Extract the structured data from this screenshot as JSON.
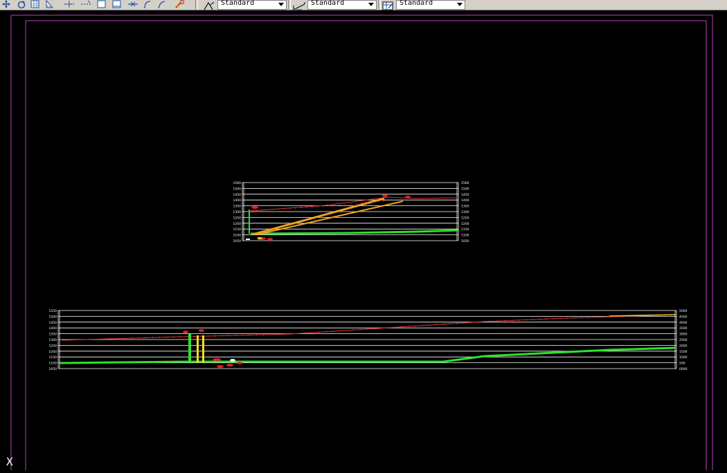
{
  "toolbar": {
    "icons": [
      "pan-icon",
      "orbit-icon",
      "grid-view-icon",
      "section-icon",
      "line-align-icon",
      "line-dash-icon",
      "rect-icon",
      "rect2-icon",
      "move-icon",
      "arc-icon",
      "curve-icon",
      "tool-settings-icon"
    ],
    "text_style": {
      "icon": "text-style-icon",
      "value": "Standard"
    },
    "dim_style": {
      "icon": "dimension-style-icon",
      "value": "Standard"
    },
    "table_style": {
      "icon": "table-style-icon",
      "value": "Standard"
    }
  },
  "drawing": {
    "border_color": "#c040c0",
    "upper_profile": {
      "ticks_left": [
        "1560",
        "1500",
        "1450",
        "1400",
        "1350",
        "1300",
        "1250",
        "1200",
        "1150",
        "1100",
        "1050"
      ],
      "ticks_right": [
        "1560",
        "1500",
        "1450",
        "1400",
        "1350",
        "1300",
        "1250",
        "1200",
        "1150",
        "1100",
        "1050"
      ]
    },
    "lower_profile": {
      "ticks_left": [
        "1550",
        "1500",
        "1450",
        "1400",
        "1350",
        "1300",
        "1250",
        "1200",
        "1150",
        "1100",
        "1050"
      ],
      "ticks_right": [
        "5000",
        "4500",
        "4000",
        "3500",
        "3000",
        "2500",
        "2000",
        "1500",
        "1000",
        "500",
        "0000"
      ]
    }
  },
  "ucs_label": "X"
}
